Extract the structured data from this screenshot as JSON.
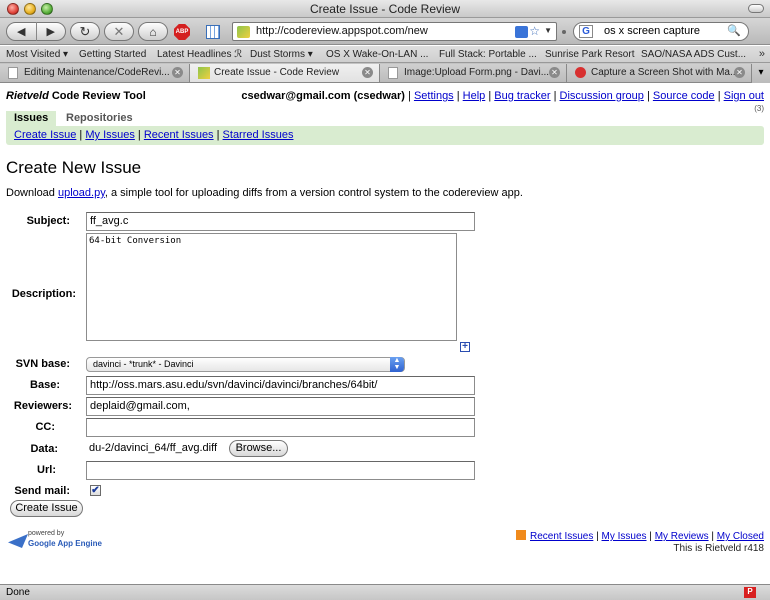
{
  "window": {
    "title": "Create Issue - Code Review"
  },
  "navbar": {
    "back_glyph": "◀",
    "forward_glyph": "▶",
    "reload_glyph": "↻",
    "stop_glyph": "✕",
    "home_glyph": "⌂",
    "abp_label": "ABP",
    "url": "http://codereview.appspot.com/new",
    "search_engine_glyph": "G",
    "search_query": "os x screen capture"
  },
  "bookmarks": {
    "items": [
      "Most Visited ▾",
      "Getting Started",
      "Latest Headlines ℛ",
      "Dust Storms ▾",
      "OS X Wake-On-LAN ...",
      "Full Stack: Portable ...",
      "Sunrise Park Resort",
      "SAO/NASA ADS Cust..."
    ],
    "more": "»"
  },
  "tabs": [
    {
      "label": "Editing Maintenance/CodeRevi..."
    },
    {
      "label": "Create Issue - Code Review"
    },
    {
      "label": "Image:Upload Form.png - Davi..."
    },
    {
      "label": "Capture a Screen Shot with Ma..."
    }
  ],
  "page": {
    "brand_italic": "Rietveld",
    "brand_rest": " Code Review Tool",
    "user": "csedwar@gmail.com (csedwar)",
    "user_links": [
      "Settings",
      "Help",
      "Bug tracker",
      "Discussion group",
      "Source code",
      "Sign out"
    ],
    "counter": "(3)",
    "main_tabs": [
      "Issues",
      "Repositories"
    ],
    "sub_links": [
      "Create Issue",
      "My Issues",
      "Recent Issues",
      "Starred Issues"
    ],
    "heading": "Create New Issue",
    "intro_prefix": "Download ",
    "intro_link": "upload.py",
    "intro_suffix": ", a simple tool for uploading diffs from a version control system to the codereview app."
  },
  "form": {
    "subject_label": "Subject:",
    "subject_value": "ff_avg.c",
    "description_label": "Description:",
    "description_value": "64-bit Conversion",
    "plus_glyph": "+",
    "svn_label": "SVN base:",
    "svn_value": "davinci - *trunk* - Davinci",
    "base_label": "Base:",
    "base_value": "http://oss.mars.asu.edu/svn/davinci/davinci/branches/64bit/",
    "reviewers_label": "Reviewers:",
    "reviewers_value": "deplaid@gmail.com,",
    "cc_label": "CC:",
    "cc_value": "",
    "data_label": "Data:",
    "data_value": "du-2/davinci_64/ff_avg.diff",
    "browse_label": "Browse...",
    "url_label": "Url:",
    "url_value": "",
    "sendmail_label": "Send mail:",
    "sendmail_checked": true,
    "submit_label": "Create Issue"
  },
  "footer": {
    "powered_by": "powered by",
    "engine": "Google App Engine",
    "links": [
      "Recent Issues",
      "My Issues",
      "My Reviews",
      "My Closed"
    ],
    "version": "This is Rietveld r418"
  },
  "status": {
    "text": "Done"
  }
}
